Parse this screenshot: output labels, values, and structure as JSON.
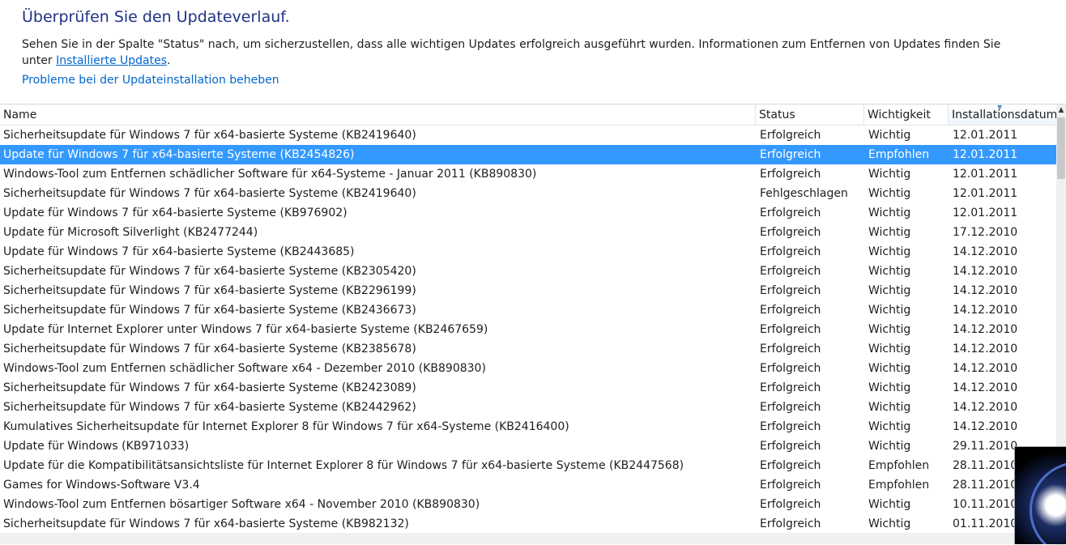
{
  "page": {
    "title": "Überprüfen Sie den Updateverlauf.",
    "description": "Sehen Sie in der Spalte \"Status\" nach, um sicherzustellen, dass alle wichtigen Updates erfolgreich ausgeführt wurden. Informationen zum Entfernen von Updates finden Sie unter ",
    "installed_updates_link": "Installierte Updates",
    "description_end": ".",
    "troubleshoot_link": "Probleme bei der Updateinstallation beheben"
  },
  "table": {
    "columns": {
      "name": "Name",
      "status": "Status",
      "importance": "Wichtigkeit",
      "date": "Installationsdatum"
    },
    "sorted_column": "date",
    "selected_row": 1,
    "rows": [
      {
        "name": "Sicherheitsupdate für Windows 7 für x64-basierte Systeme (KB2419640)",
        "status": "Erfolgreich",
        "importance": "Wichtig",
        "date": "12.01.2011"
      },
      {
        "name": "Update für Windows 7 für x64-basierte Systeme (KB2454826)",
        "status": "Erfolgreich",
        "importance": "Empfohlen",
        "date": "12.01.2011"
      },
      {
        "name": "Windows-Tool zum Entfernen schädlicher Software für x64-Systeme - Januar 2011 (KB890830)",
        "status": "Erfolgreich",
        "importance": "Wichtig",
        "date": "12.01.2011"
      },
      {
        "name": "Sicherheitsupdate für Windows 7 für x64-basierte Systeme (KB2419640)",
        "status": "Fehlgeschlagen",
        "importance": "Wichtig",
        "date": "12.01.2011"
      },
      {
        "name": "Update für Windows 7 für x64-basierte Systeme (KB976902)",
        "status": "Erfolgreich",
        "importance": "Wichtig",
        "date": "12.01.2011"
      },
      {
        "name": "Update für Microsoft Silverlight (KB2477244)",
        "status": "Erfolgreich",
        "importance": "Wichtig",
        "date": "17.12.2010"
      },
      {
        "name": "Update für Windows 7 für x64-basierte Systeme (KB2443685)",
        "status": "Erfolgreich",
        "importance": "Wichtig",
        "date": "14.12.2010"
      },
      {
        "name": "Sicherheitsupdate für Windows 7 für x64-basierte Systeme (KB2305420)",
        "status": "Erfolgreich",
        "importance": "Wichtig",
        "date": "14.12.2010"
      },
      {
        "name": "Sicherheitsupdate für Windows 7 für x64-basierte Systeme (KB2296199)",
        "status": "Erfolgreich",
        "importance": "Wichtig",
        "date": "14.12.2010"
      },
      {
        "name": "Sicherheitsupdate für Windows 7 für x64-basierte Systeme (KB2436673)",
        "status": "Erfolgreich",
        "importance": "Wichtig",
        "date": "14.12.2010"
      },
      {
        "name": "Update für Internet Explorer unter Windows 7 für x64-basierte Systeme (KB2467659)",
        "status": "Erfolgreich",
        "importance": "Wichtig",
        "date": "14.12.2010"
      },
      {
        "name": "Sicherheitsupdate für Windows 7 für x64-basierte Systeme (KB2385678)",
        "status": "Erfolgreich",
        "importance": "Wichtig",
        "date": "14.12.2010"
      },
      {
        "name": "Windows-Tool zum Entfernen schädlicher Software x64 - Dezember 2010 (KB890830)",
        "status": "Erfolgreich",
        "importance": "Wichtig",
        "date": "14.12.2010"
      },
      {
        "name": "Sicherheitsupdate für Windows 7 für x64-basierte Systeme (KB2423089)",
        "status": "Erfolgreich",
        "importance": "Wichtig",
        "date": "14.12.2010"
      },
      {
        "name": "Sicherheitsupdate für Windows 7 für x64-basierte Systeme (KB2442962)",
        "status": "Erfolgreich",
        "importance": "Wichtig",
        "date": "14.12.2010"
      },
      {
        "name": "Kumulatives Sicherheitsupdate für Internet Explorer 8 für Windows 7 für x64-Systeme (KB2416400)",
        "status": "Erfolgreich",
        "importance": "Wichtig",
        "date": "14.12.2010"
      },
      {
        "name": "Update für Windows (KB971033)",
        "status": "Erfolgreich",
        "importance": "Wichtig",
        "date": "29.11.2010"
      },
      {
        "name": "Update für die Kompatibilitätsansichtsliste für Internet Explorer 8 für Windows 7 für x64-basierte Systeme (KB2447568)",
        "status": "Erfolgreich",
        "importance": "Empfohlen",
        "date": "28.11.2010"
      },
      {
        "name": "Games for Windows-Software V3.4",
        "status": "Erfolgreich",
        "importance": "Empfohlen",
        "date": "28.11.2010"
      },
      {
        "name": "Windows-Tool zum Entfernen bösartiger Software x64 - November 2010 (KB890830)",
        "status": "Erfolgreich",
        "importance": "Wichtig",
        "date": "10.11.2010"
      },
      {
        "name": "Sicherheitsupdate für Windows 7 für x64-basierte Systeme (KB982132)",
        "status": "Erfolgreich",
        "importance": "Wichtig",
        "date": "01.11.2010"
      }
    ]
  },
  "colors": {
    "title": "#1e3287",
    "link": "#0066cc",
    "selection": "#3399ff"
  }
}
